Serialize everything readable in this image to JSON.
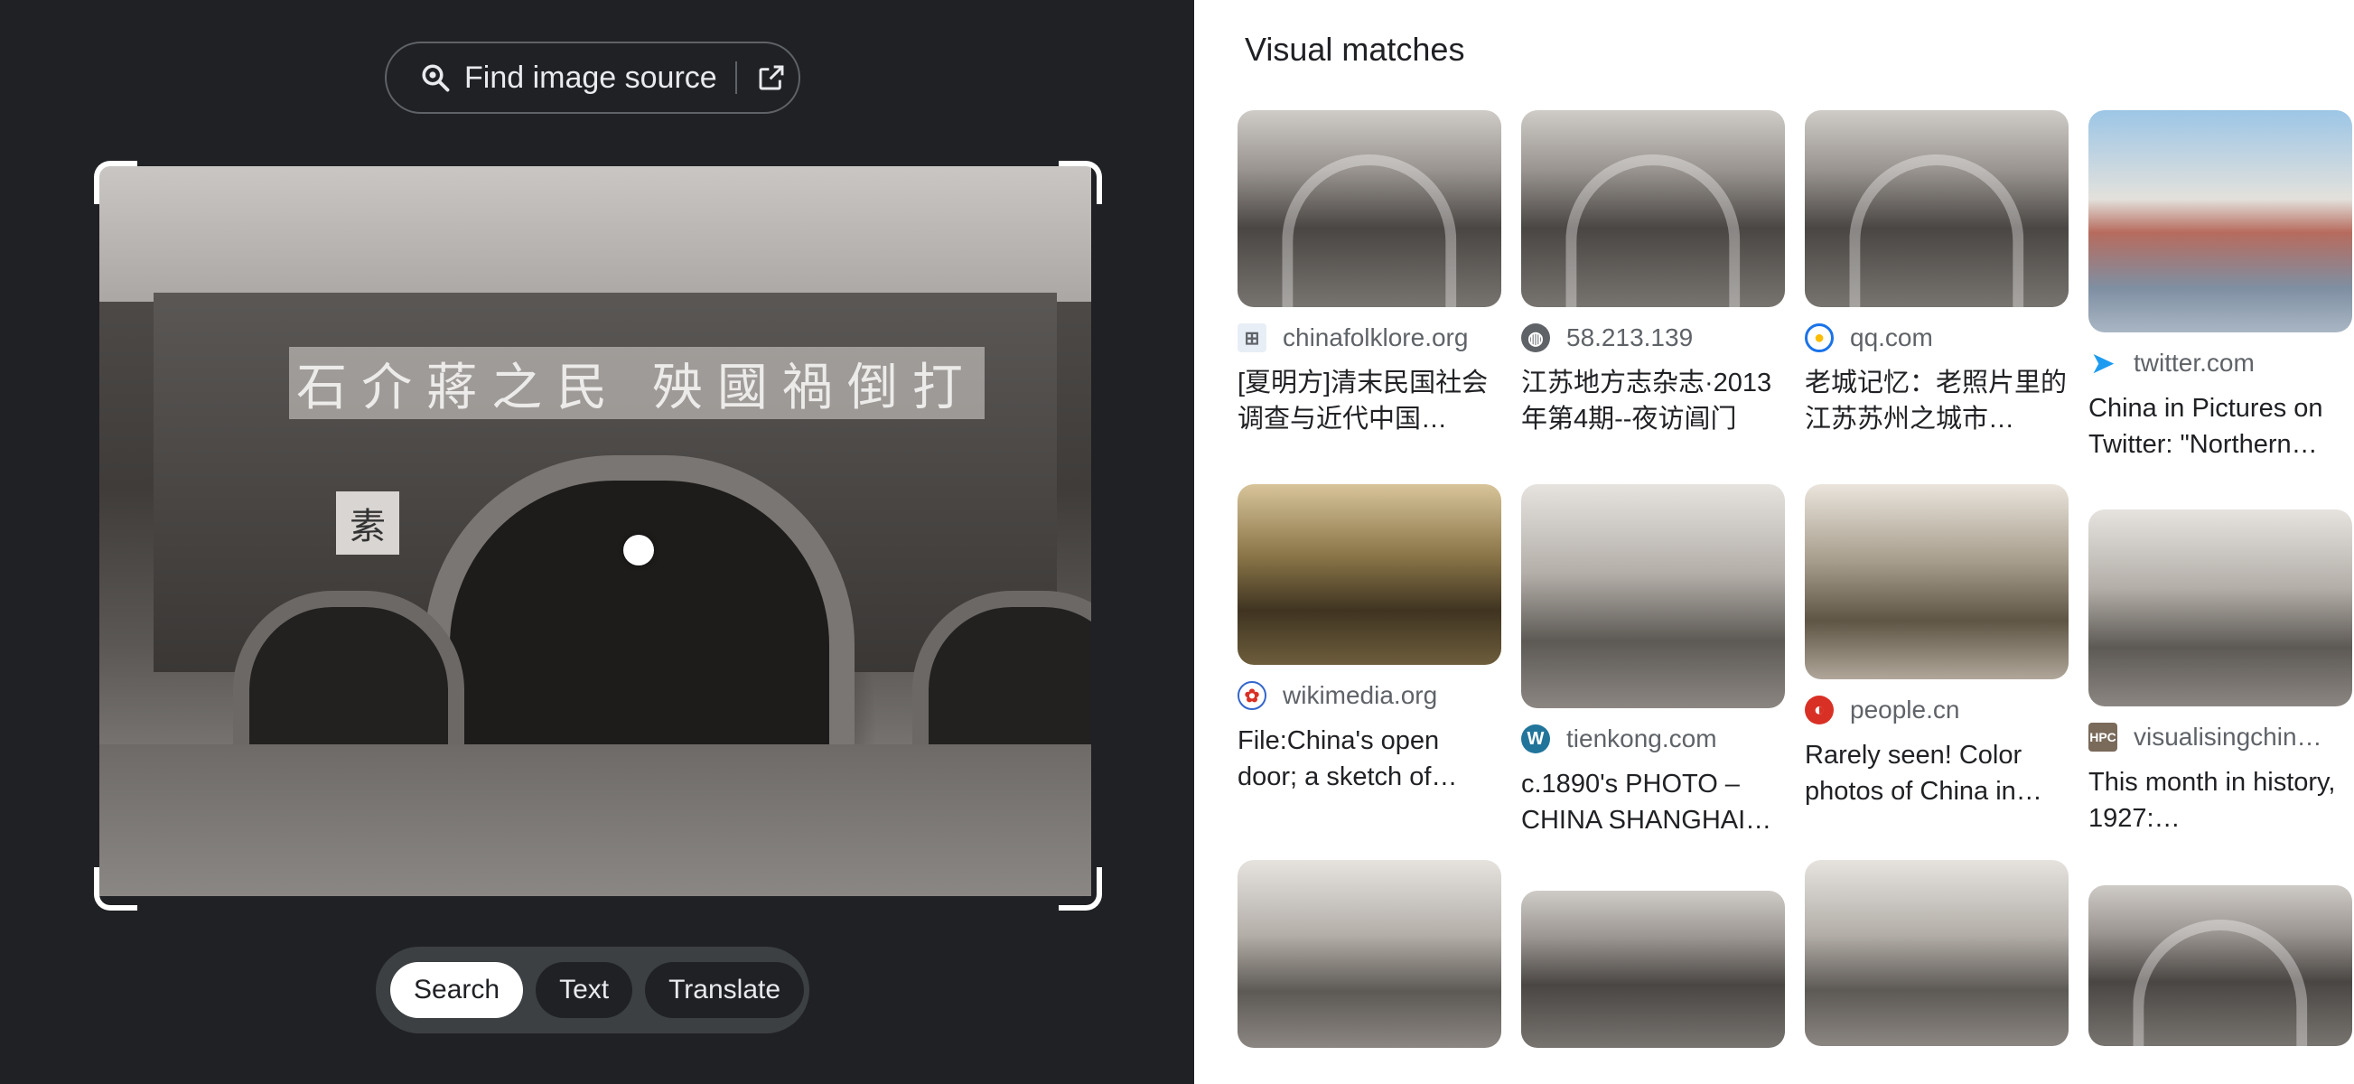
{
  "left_panel": {
    "find_source_label": "Find image source",
    "photo_banner_text": "石介蔣之民 殃國禍倒打",
    "photo_sign_text": "素",
    "modes": [
      {
        "label": "Search",
        "active": true
      },
      {
        "label": "Text",
        "active": false
      },
      {
        "label": "Translate",
        "active": false
      }
    ]
  },
  "right_panel": {
    "title": "Visual matches",
    "results": [
      {
        "source": "chinafolklore.org",
        "icon": "chinafolklore-icon",
        "title": "[夏明方]清末民国社会调查与近代中国…"
      },
      {
        "source": "58.213.139",
        "icon": "globe-icon",
        "title": "江苏地方志杂志·2013年第4期--夜访阊门"
      },
      {
        "source": "qq.com",
        "icon": "qq-icon",
        "title": "老城记忆：老照片里的江苏苏州之城市…"
      },
      {
        "source": "twitter.com",
        "icon": "twitter-icon",
        "title": "China in Pictures on Twitter: \"Northern…"
      },
      {
        "source": "wikimedia.org",
        "icon": "wikimedia-icon",
        "title": "File:China's open door; a sketch of…"
      },
      {
        "source": "tienkong.com",
        "icon": "wordpress-icon",
        "title": "c.1890's PHOTO – CHINA SHANGHAI…"
      },
      {
        "source": "people.cn",
        "icon": "people-icon",
        "title": "Rarely seen! Color photos of China in…"
      },
      {
        "source": "visualisingchin…",
        "icon": "hpc-icon",
        "title": "This month in history, 1927:…"
      }
    ]
  },
  "colors": {
    "left_bg": "#202124",
    "accent_active": "#ffffff",
    "twitter": "#1d9bf0",
    "people": "#d93025",
    "wordpress": "#21759b",
    "wikimedia": "#3366cc"
  }
}
